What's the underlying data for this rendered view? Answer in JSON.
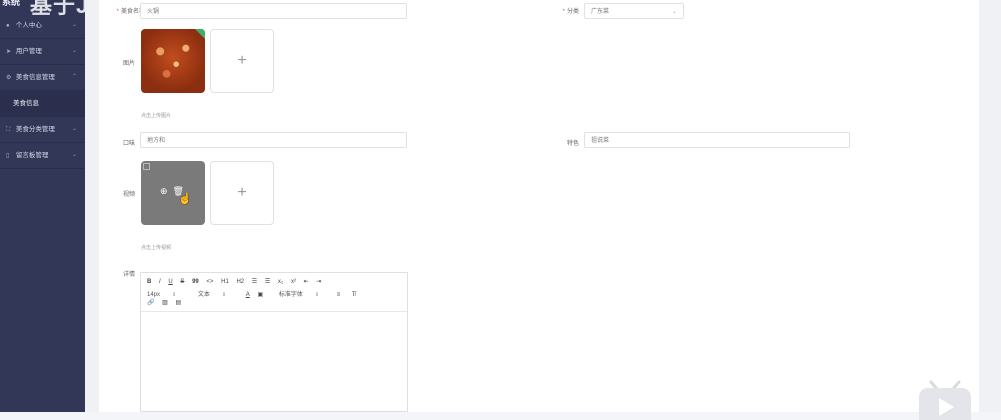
{
  "overlay": {
    "title": "基于Java个性化美食推荐管理"
  },
  "sidebar": {
    "header": "系统",
    "items": [
      {
        "label": "个人中心",
        "icon": "user-icon"
      },
      {
        "label": "用户管理",
        "icon": "send-icon"
      },
      {
        "label": "美食信息管理",
        "icon": "gear-icon",
        "sub": "美食信息"
      },
      {
        "label": "美食分类管理",
        "icon": "expand-icon"
      },
      {
        "label": "留言板管理",
        "icon": "document-icon"
      }
    ]
  },
  "form": {
    "name_label": "美食名称",
    "name_value": "火锅",
    "category_label": "分类",
    "category_value": "广东菜",
    "image_label": "图片",
    "image_hint": "点击上传图片",
    "taste_label": "口味",
    "taste_value": "地方和",
    "feature_label": "特色",
    "feature_value": "祖说菜",
    "video_label": "视频",
    "video_hint": "点击上传视频",
    "detail_label": "详情"
  },
  "editor": {
    "row1": [
      "B",
      "I",
      "U",
      "S",
      "99",
      "<>",
      "H1",
      "H2",
      "☰",
      "☰",
      "x₂",
      "x²",
      "⇤",
      "⇥"
    ],
    "font_size": "14px",
    "text_type": "文本",
    "font_family": "标准字体",
    "row3": [
      "link",
      "image",
      "video"
    ]
  }
}
